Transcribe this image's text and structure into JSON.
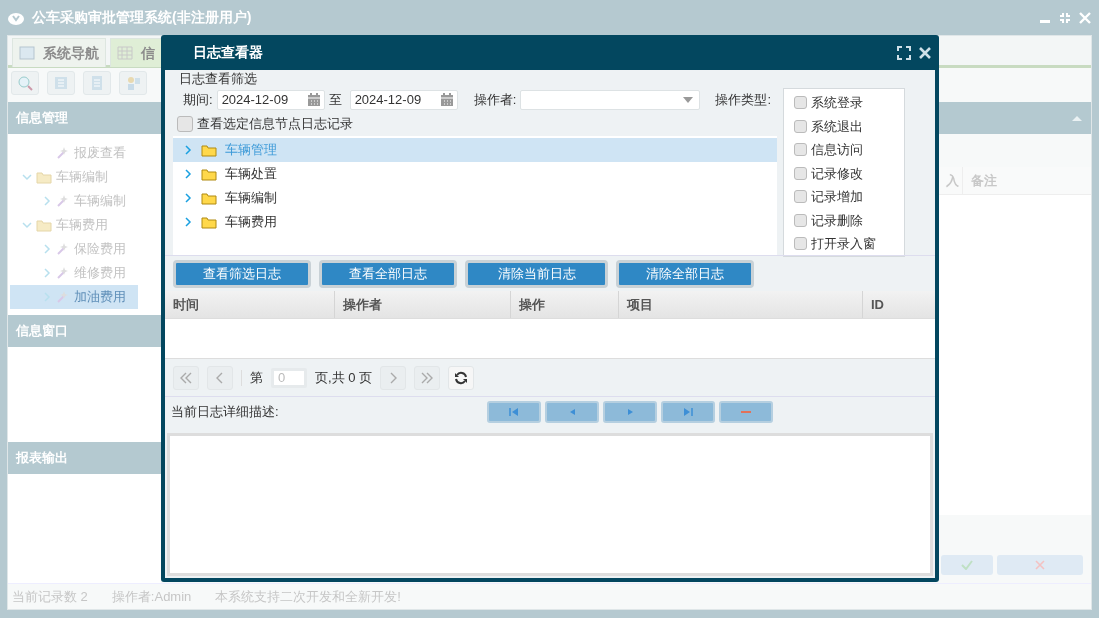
{
  "window": {
    "title": "公车采购审批管理系统(非注册用户)"
  },
  "tabs": [
    {
      "label": "系统导航",
      "selected": false
    },
    {
      "label": "信",
      "selected": true
    }
  ],
  "sidebar": {
    "panels": [
      {
        "title": "信息管理",
        "tree": [
          {
            "label": "报废查看",
            "kind": "leaf",
            "selected": false
          },
          {
            "label": "车辆编制",
            "kind": "folder",
            "selected": false,
            "expanded": true,
            "children": [
              {
                "label": "车辆编制",
                "kind": "leaf",
                "selected": false
              }
            ]
          },
          {
            "label": "车辆费用",
            "kind": "folder",
            "selected": false,
            "expanded": true,
            "children": [
              {
                "label": "保险费用",
                "kind": "leaf",
                "selected": false
              },
              {
                "label": "维修费用",
                "kind": "leaf",
                "selected": false
              },
              {
                "label": "加油费用",
                "kind": "leaf",
                "selected": true
              }
            ]
          }
        ]
      },
      {
        "title": "信息窗口"
      },
      {
        "title": "报表输出"
      }
    ]
  },
  "main": {
    "columns": [
      "入",
      "备注"
    ]
  },
  "status_bar": [
    "当前记录数 2",
    "操作者:Admin",
    "本系统支持二次开发和全新开发!"
  ],
  "dialog": {
    "title": "日志查看器",
    "filter_legend": "日志查看筛选",
    "period_label": "期间:",
    "date_from": "2024-12-09",
    "to_label": "至",
    "date_to": "2024-12-09",
    "operator_label": "操作者:",
    "op_type_label": "操作类型:",
    "op_types": [
      {
        "label": "系统登录",
        "checked": false
      },
      {
        "label": "系统退出",
        "checked": false
      },
      {
        "label": "信息访问",
        "checked": false
      },
      {
        "label": "记录修改",
        "checked": false
      },
      {
        "label": "记录增加",
        "checked": false
      },
      {
        "label": "记录删除",
        "checked": false
      },
      {
        "label": "打开录入窗",
        "checked": false
      }
    ],
    "node_filter": {
      "label": "查看选定信息节点日志记录",
      "checked": false
    },
    "tree": [
      {
        "label": "车辆管理",
        "selected": true
      },
      {
        "label": "车辆处置",
        "selected": false
      },
      {
        "label": "车辆编制",
        "selected": false
      },
      {
        "label": "车辆费用",
        "selected": false
      }
    ],
    "buttons": [
      "查看筛选日志",
      "查看全部日志",
      "清除当前日志",
      "清除全部日志"
    ],
    "columns": [
      "时间",
      "操作者",
      "操作",
      "项目",
      "ID"
    ],
    "pager": {
      "page_label": "第",
      "page": "0",
      "total_label": "页,共 0 页"
    },
    "detail_label": "当前日志详细描述:"
  }
}
